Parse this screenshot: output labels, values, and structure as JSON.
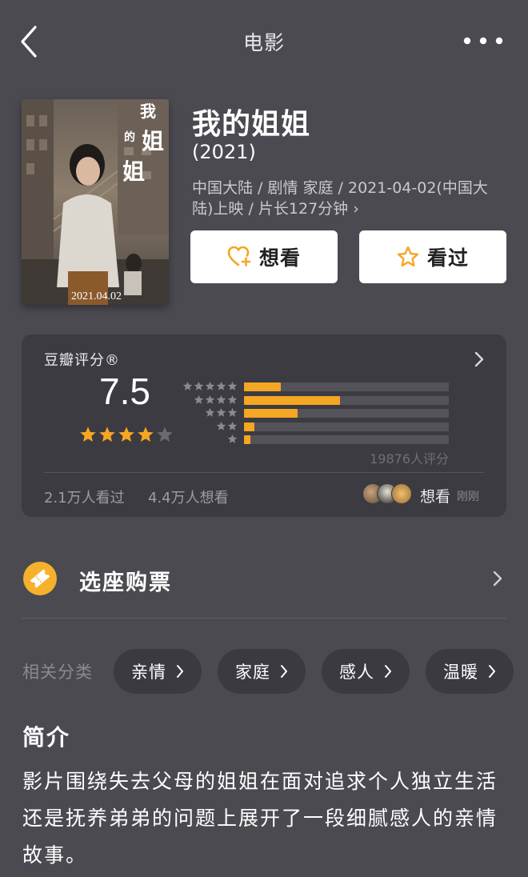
{
  "header": {
    "title": "电影"
  },
  "movie": {
    "title": "我的姐姐",
    "year": "(2021)",
    "meta": "中国大陆 / 剧情 家庭 / 2021-04-02(中国大陆)上映 / 片长127分钟 ›",
    "poster": {
      "title": "我的姐姐",
      "date": "2021.04.02"
    }
  },
  "actions": {
    "want_label": "想看",
    "seen_label": "看过"
  },
  "rating": {
    "source": "豆瓣评分®",
    "score": "7.5",
    "stars": 4,
    "distribution": [
      {
        "stars": 5,
        "percent": 18
      },
      {
        "stars": 4,
        "percent": 47
      },
      {
        "stars": 3,
        "percent": 26
      },
      {
        "stars": 2,
        "percent": 5
      },
      {
        "stars": 1,
        "percent": 3
      }
    ],
    "count": "19876人评分",
    "seen_stat": "2.1万人看过",
    "want_stat": "4.4万人想看",
    "activity": {
      "action": "想看",
      "time": "刚刚"
    },
    "colors": {
      "bar": "#f5a623",
      "track": "#54535a",
      "star_on": "#f5a623",
      "star_off": "#6b6a70"
    }
  },
  "ticket": {
    "label": "选座购票"
  },
  "categories": {
    "label": "相关分类",
    "items": [
      "亲情",
      "家庭",
      "感人",
      "温暖"
    ]
  },
  "intro": {
    "title": "简介",
    "text": "影片围绕失去父母的姐姐在面对追求个人独立生活还是抚养弟弟的问题上展开了一段细腻感人的亲情故事。"
  }
}
